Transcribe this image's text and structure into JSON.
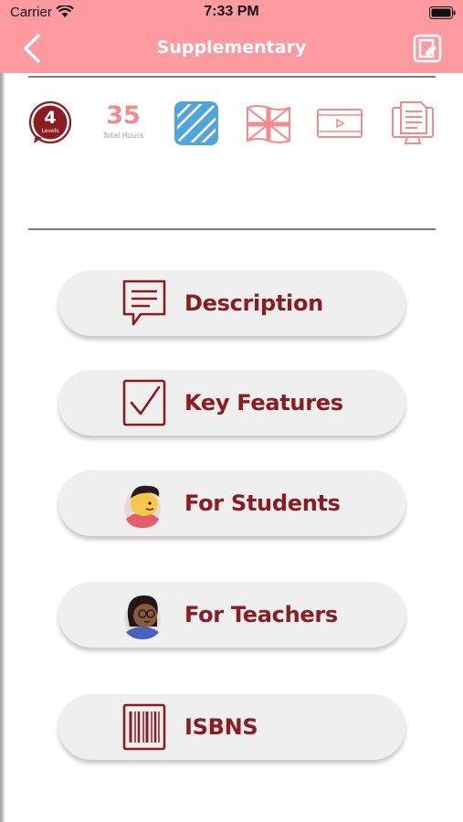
{
  "status_bar": {
    "carrier": "Carrier",
    "time": "7:33 PM"
  },
  "nav": {
    "title": "Supplementary",
    "back_icon": "chevron-left-icon",
    "action_icon": "document-icon"
  },
  "summary": {
    "levels_count": "4",
    "levels_label": "Levels",
    "hours_count": "35",
    "hours_label": "Total Hours",
    "icons": [
      "stripes-icon",
      "uk-flag-icon",
      "video-icon",
      "computer-document-icon"
    ]
  },
  "menu": [
    {
      "label": "Description",
      "icon": "speech-bubble-icon"
    },
    {
      "label": "Key Features",
      "icon": "checkbox-icon"
    },
    {
      "label": "For Students",
      "icon": "student-avatar-icon"
    },
    {
      "label": "For Teachers",
      "icon": "teacher-avatar-icon"
    },
    {
      "label": "ISBNS",
      "icon": "barcode-icon"
    }
  ],
  "colors": {
    "header": "#ff9aa0",
    "brand_dark": "#8a1c22",
    "accent_blue": "#4fa5dc",
    "accent_pink": "#f28a8e"
  }
}
